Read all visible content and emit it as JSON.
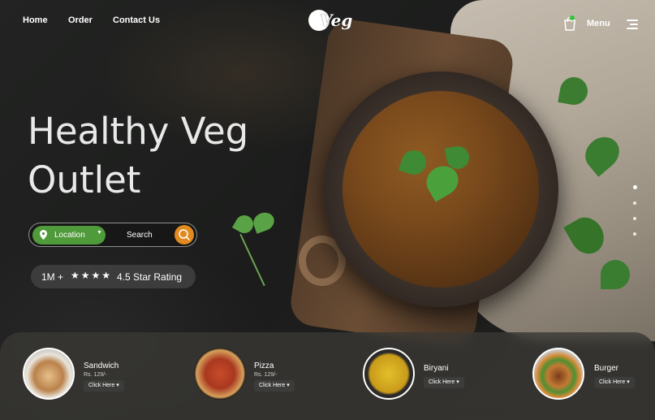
{
  "nav": {
    "links": [
      "Home",
      "Order",
      "Contact Us"
    ],
    "logo_text": "Veg",
    "menu_label": "Menu",
    "cart_icon": "shopping-bag-icon",
    "menu_icon": "hamburger-icon"
  },
  "hero": {
    "title_line1": "Healthy Veg",
    "title_line2": "Outlet",
    "location_label": "Location",
    "search_label": "Search",
    "rating_count": "1M +",
    "rating_stars": "★★★★",
    "rating_label": "4.5 Star Rating",
    "carousel": {
      "slides": 4,
      "active_index": 0
    }
  },
  "products": [
    {
      "name": "Sandwich",
      "price": "Rs. 129/-",
      "button": "Click Here",
      "image": "sandwich-image"
    },
    {
      "name": "Pizza",
      "price": "Rs. 129/-",
      "button": "Click Here",
      "image": "pizza-image"
    },
    {
      "name": "Biryani",
      "price": "",
      "button": "Click Here",
      "image": "biryani-image"
    },
    {
      "name": "Burger",
      "price": "",
      "button": "Click Here",
      "image": "burger-image"
    }
  ],
  "colors": {
    "accent_green": "#4f9a3a",
    "accent_orange": "#e08a1f",
    "cart_badge": "#37c13a"
  }
}
